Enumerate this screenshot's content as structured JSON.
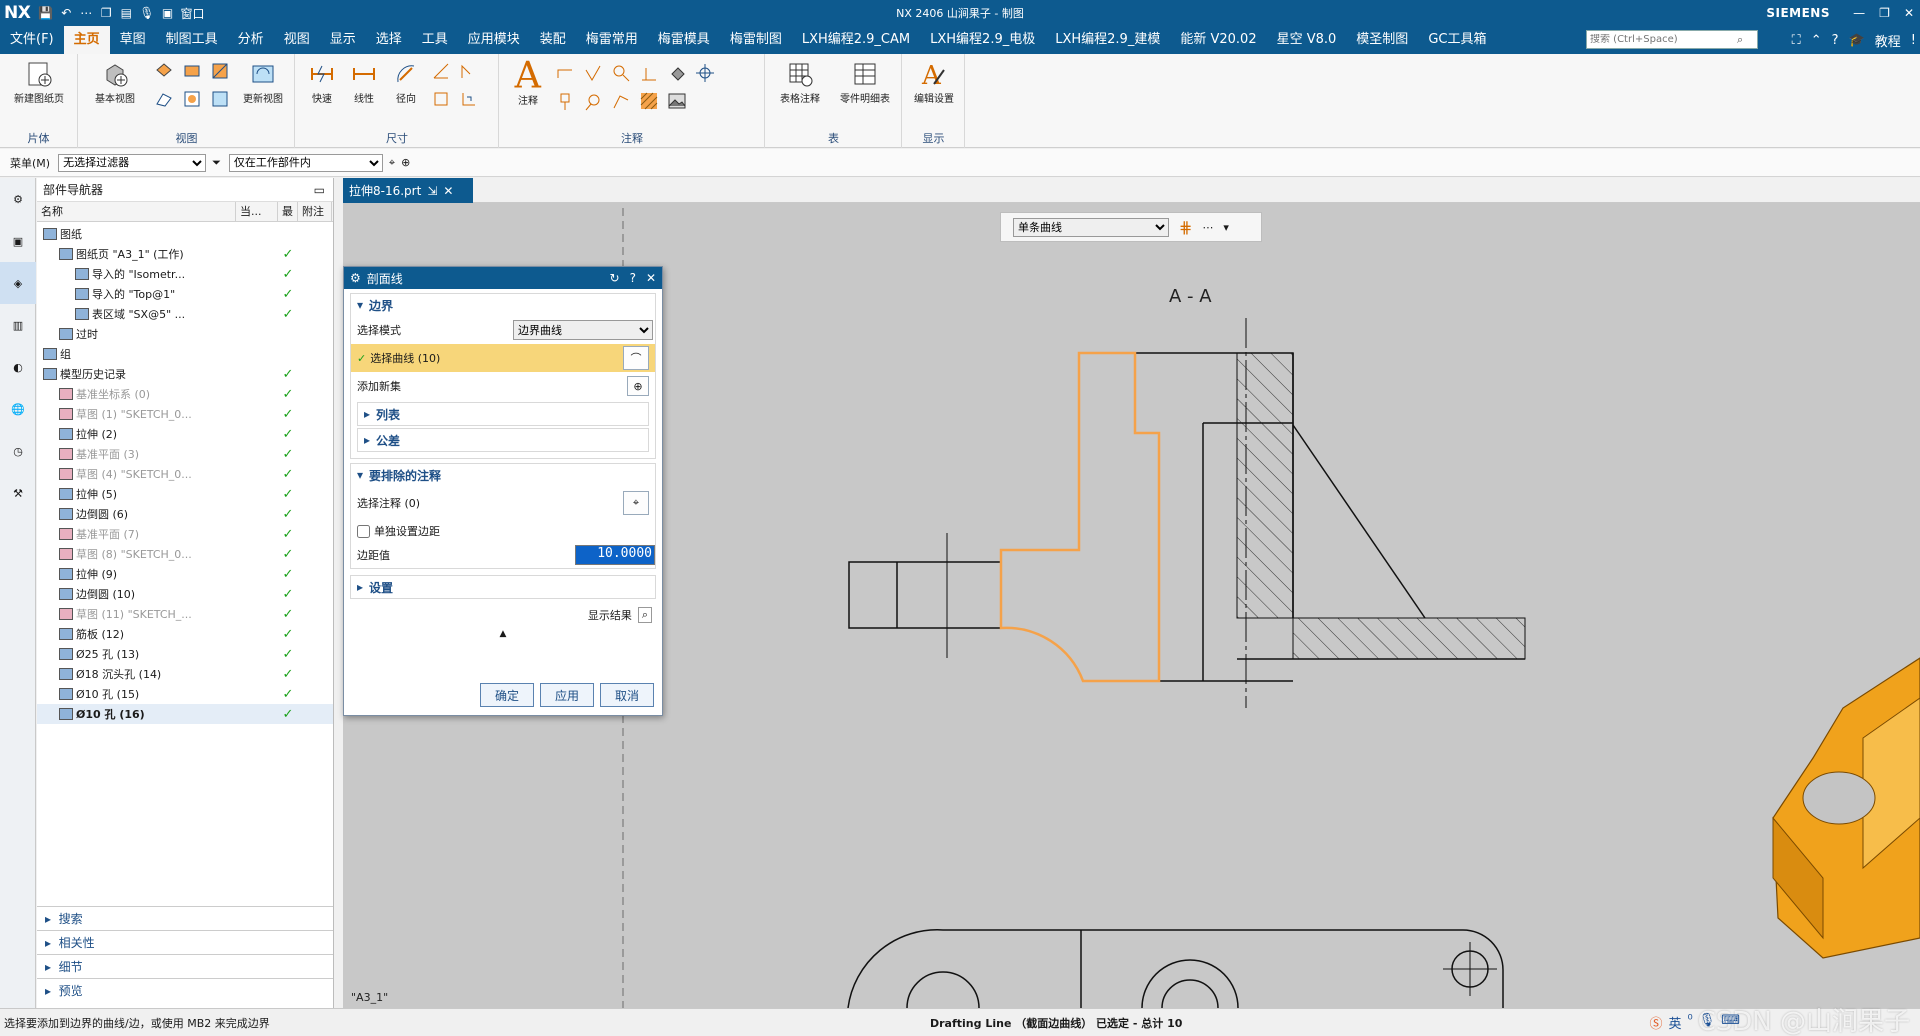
{
  "titlebar": {
    "logo": "NX",
    "window_menu": "窗口",
    "title": "NX 2406 山涧果子 - 制图",
    "brand": "SIEMENS"
  },
  "menubar": {
    "items": [
      "文件(F)",
      "主页",
      "草图",
      "制图工具",
      "分析",
      "视图",
      "显示",
      "选择",
      "工具",
      "应用模块",
      "装配",
      "梅雷常用",
      "梅雷模具",
      "梅雷制图",
      "LXH编程2.9_CAM",
      "LXH编程2.9_电极",
      "LXH编程2.9_建模",
      "能新 V20.02",
      "星空 V8.0",
      "模圣制图",
      "GC工具箱"
    ],
    "active_index": 1,
    "search_placeholder": "搜索 (Ctrl+Space)",
    "tutorial": "教程"
  },
  "ribbon": {
    "groups": [
      {
        "label": "片体",
        "buttons": [
          "新建图纸页"
        ]
      },
      {
        "label": "视图",
        "buttons": [
          "基本视图",
          "更新视图"
        ]
      },
      {
        "label": "尺寸",
        "buttons": [
          "快速",
          "线性",
          "径向"
        ]
      },
      {
        "label": "注释",
        "buttons": [
          "注释"
        ]
      },
      {
        "label": "表",
        "buttons": [
          "表格注释",
          "零件明细表"
        ]
      },
      {
        "label": "显示",
        "buttons": [
          "编辑设置"
        ]
      }
    ]
  },
  "selbar": {
    "menu": "菜单(M)",
    "filter": "无选择过滤器",
    "scope": "仅在工作部件内"
  },
  "navigator": {
    "title": "部件导航器",
    "columns": [
      "名称",
      "当...",
      "最",
      "附注"
    ],
    "rows": [
      {
        "text": "图纸",
        "style": "normal",
        "check": ""
      },
      {
        "text": "图纸页 \"A3_1\" (工作)",
        "style": "normal",
        "check": "✓"
      },
      {
        "text": "导入的 \"Isometr...",
        "style": "normal",
        "check": "✓"
      },
      {
        "text": "导入的 \"Top@1\"",
        "style": "normal",
        "check": "✓"
      },
      {
        "text": "表区域 \"SX@5\" ...",
        "style": "normal",
        "check": "✓"
      },
      {
        "text": "过时",
        "style": "normal",
        "check": ""
      },
      {
        "text": "组",
        "style": "normal",
        "check": ""
      },
      {
        "text": "模型历史记录",
        "style": "normal",
        "check": "✓"
      },
      {
        "text": "基准坐标系 (0)",
        "style": "dim",
        "check": "✓"
      },
      {
        "text": "草图 (1) \"SKETCH_0...",
        "style": "dim",
        "check": "✓"
      },
      {
        "text": "拉伸 (2)",
        "style": "normal",
        "check": "✓"
      },
      {
        "text": "基准平面 (3)",
        "style": "dim",
        "check": "✓"
      },
      {
        "text": "草图 (4) \"SKETCH_0...",
        "style": "dim",
        "check": "✓"
      },
      {
        "text": "拉伸 (5)",
        "style": "normal",
        "check": "✓"
      },
      {
        "text": "边倒圆 (6)",
        "style": "normal",
        "check": "✓"
      },
      {
        "text": "基准平面 (7)",
        "style": "dim",
        "check": "✓"
      },
      {
        "text": "草图 (8) \"SKETCH_0...",
        "style": "dim",
        "check": "✓"
      },
      {
        "text": "拉伸 (9)",
        "style": "normal",
        "check": "✓"
      },
      {
        "text": "边倒圆 (10)",
        "style": "normal",
        "check": "✓"
      },
      {
        "text": "草图 (11) \"SKETCH_...",
        "style": "dim",
        "check": "✓"
      },
      {
        "text": "筋板 (12)",
        "style": "normal",
        "check": "✓"
      },
      {
        "text": "Ø25 孔 (13)",
        "style": "normal",
        "check": "✓"
      },
      {
        "text": "Ø18 沉头孔 (14)",
        "style": "normal",
        "check": "✓"
      },
      {
        "text": "Ø10 孔 (15)",
        "style": "normal",
        "check": "✓"
      },
      {
        "text": "Ø10 孔 (16)",
        "style": "bold",
        "check": "✓"
      }
    ],
    "bottom_sections": [
      "搜索",
      "相关性",
      "细节",
      "预览"
    ]
  },
  "document_tab": "拉伸8-16.prt",
  "float_toolbar": {
    "curve_rule": "单条曲线"
  },
  "drawing": {
    "section_label": "A - A",
    "sheet_name": "\"A3_1\""
  },
  "dialog": {
    "title": "剖面线",
    "boundary_section": "边界",
    "select_mode_label": "选择模式",
    "select_mode_value": "边界曲线",
    "select_curve": "选择曲线 (10)",
    "add_new_set": "添加新集",
    "list": "列表",
    "tolerance": "公差",
    "exclude_section": "要排除的注释",
    "select_annotation": "选择注释 (0)",
    "single_margin": "单独设置边距",
    "margin_label": "边距值",
    "margin_value": "10.0000",
    "settings": "设置",
    "show_result": "显示结果",
    "ok": "确定",
    "apply": "应用",
    "cancel": "取消"
  },
  "statusbar": {
    "prompt": "选择要添加到边界的曲线/边，或使用 MB2 来完成边界",
    "info": "Drafting Line （截面边曲线） 已选定 - 总计 10",
    "watermark": "CSDN @山涧果子",
    "ime": "英"
  },
  "colors": {
    "title_blue": "#0d5a8f",
    "active_orange": "#d46b00",
    "highlight_curve": "#f5a24a",
    "model_orange": "#f0a21c",
    "check_green": "#1aa11a"
  }
}
